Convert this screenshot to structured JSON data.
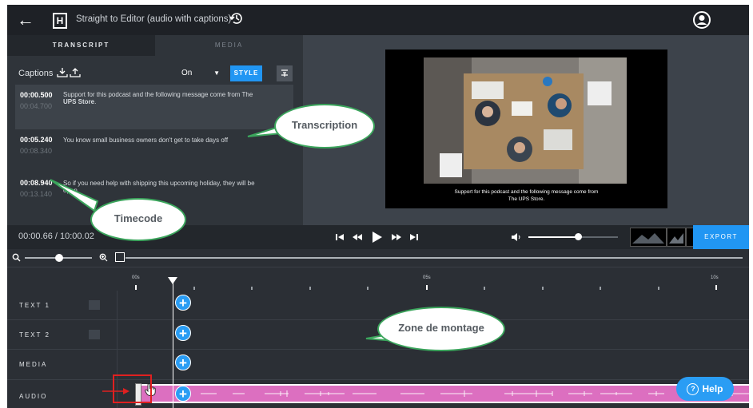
{
  "header": {
    "back_icon": "arrow-left-icon",
    "logo_letter": "H",
    "project_title": "Straight to Editor (audio with captions)",
    "history_icon": "history-icon",
    "user_icon": "user-account-icon"
  },
  "left_panel": {
    "tabs": [
      {
        "label": "TRANSCRIPT",
        "active": true
      },
      {
        "label": "MEDIA",
        "active": false
      }
    ],
    "captions_label": "Captions",
    "captions_toggle": "On",
    "style_button": "STYLE",
    "segments": [
      {
        "start": "00:00.500",
        "end": "00:04.700",
        "text": "Support for this podcast and the following message come from The ",
        "bold": "UPS Store",
        "tail": ".",
        "highlighted": true
      },
      {
        "start": "00:05.240",
        "end": "00:08.340",
        "text": "You know small business owners don't get to take days off",
        "highlighted": false
      },
      {
        "start": "00:08.940",
        "end": "00:13.140",
        "text": "So if you need help with shipping this upcoming holiday, they will be open.",
        "highlighted": false
      }
    ]
  },
  "preview": {
    "caption_line1": "Support for this podcast and the following message come from",
    "caption_line2": "The UPS Store."
  },
  "playback": {
    "timecode": "00:00.66 / 10:00.02",
    "volume": 0.55,
    "export_label": "EXPORT"
  },
  "ruler": {
    "labels": [
      "00s",
      "05s",
      "10s"
    ]
  },
  "tracks": [
    {
      "label": "TEXT 1"
    },
    {
      "label": "TEXT 2"
    },
    {
      "label": "MEDIA"
    },
    {
      "label": "AUDIO"
    }
  ],
  "annotations": {
    "transcription": "Transcription",
    "timecode": "Timecode",
    "zone": "Zone de montage"
  },
  "help": {
    "label": "Help"
  },
  "colors": {
    "accent": "#2196f3",
    "audio_clip": "#dc6fc0",
    "annotation_border": "#3ba55c",
    "arrow_red": "#e02020"
  }
}
